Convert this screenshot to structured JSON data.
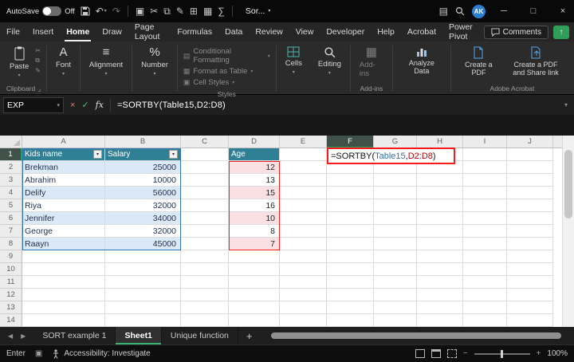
{
  "titlebar": {
    "autosave_label": "AutoSave",
    "autosave_state": "Off",
    "doc_title": "Sor...",
    "avatar": "AK"
  },
  "ribbon_tabs": {
    "items": [
      {
        "label": "File"
      },
      {
        "label": "Insert"
      },
      {
        "label": "Home"
      },
      {
        "label": "Draw"
      },
      {
        "label": "Page Layout"
      },
      {
        "label": "Formulas"
      },
      {
        "label": "Data"
      },
      {
        "label": "Review"
      },
      {
        "label": "View"
      },
      {
        "label": "Developer"
      },
      {
        "label": "Help"
      },
      {
        "label": "Acrobat"
      },
      {
        "label": "Power Pivot"
      }
    ],
    "active_tab": "Home",
    "comments_label": "Comments"
  },
  "ribbon": {
    "paste_label": "Paste",
    "font_label": "Font",
    "alignment_label": "Alignment",
    "number_label": "Number",
    "styles_items": [
      {
        "label": "Conditional Formatting"
      },
      {
        "label": "Format as Table"
      },
      {
        "label": "Cell Styles"
      }
    ],
    "cells_label": "Cells",
    "editing_label": "Editing",
    "addins_label": "Add-ins",
    "analyze_label": "Analyze Data",
    "pdf_label": "Create a PDF",
    "pdf_share_label": "Create a PDF and Share link",
    "group_labels": {
      "clipboard": "Clipboard",
      "styles": "Styles",
      "addins": "Add-ins",
      "acrobat": "Adobe Acrobat"
    }
  },
  "formula_bar": {
    "name_box": "EXP",
    "cancel": "×",
    "enter": "✓",
    "fx_label": "fx",
    "formula": "=SORTBY(Table15,D2:D8)"
  },
  "grid": {
    "col_labels": [
      "A",
      "B",
      "C",
      "D",
      "E",
      "F",
      "G",
      "H",
      "I",
      "J"
    ],
    "row_labels": [
      "1",
      "2",
      "3",
      "4",
      "5",
      "6",
      "7",
      "8",
      "9",
      "10",
      "11",
      "12",
      "13",
      "14"
    ],
    "active_cell_ref": "F1",
    "table": {
      "header_name": "Kids name",
      "header_salary": "Salary",
      "rows": [
        {
          "name": "Brekman",
          "salary": "25000"
        },
        {
          "name": "Abrahim",
          "salary": "10000"
        },
        {
          "name": "Delify",
          "salary": "56000"
        },
        {
          "name": "Riya",
          "salary": "32000"
        },
        {
          "name": "Jennifer",
          "salary": "34000"
        },
        {
          "name": "George",
          "salary": "32000"
        },
        {
          "name": "Raayn",
          "salary": "45000"
        }
      ]
    },
    "age": {
      "header": "Age",
      "values": [
        "12",
        "13",
        "15",
        "16",
        "10",
        "8",
        "7"
      ]
    },
    "active_cell": {
      "prefix": "=SORTBY(",
      "ref1": "Table15",
      "sep": ",",
      "ref2": "D2:D8",
      "suffix": ")"
    }
  },
  "sheet_tabs": {
    "items": [
      {
        "label": "SORT example 1"
      },
      {
        "label": "Sheet1"
      },
      {
        "label": "Unique function"
      }
    ],
    "active_tab": "Sheet1",
    "add_label": "+"
  },
  "status_bar": {
    "mode": "Enter",
    "accessibility": "Accessibility: Investigate",
    "zoom": "100%"
  },
  "icons": {
    "dropdown": "▾",
    "undo": "↶",
    "redo": "↷",
    "clipboard": "▣",
    "cut": "✂",
    "copy": "⧉",
    "painter": "✎",
    "borders": "⊞",
    "table": "▦",
    "sum": "∑",
    "ribbon_options": "▤",
    "minimize": "─",
    "maximize": "□",
    "close": "×",
    "font_glyph": "A",
    "alignment_glyph": "≡",
    "number_glyph": "%",
    "addins_glyph": "▦",
    "dialog_launcher": "⌟",
    "tab_prev": "◀",
    "tab_next": "▶",
    "macro": "▣",
    "zoom_out": "−",
    "zoom_in": "+",
    "share_arrow": "↑"
  },
  "colors": {
    "table_header": "#2f7f95",
    "band_blue": "#dbe9f6",
    "band_pink": "#fadfe3",
    "range_border": "#fb2020",
    "ref1_color": "#2e75b6",
    "ref2_color": "#c00000",
    "accent_green": "#27a066"
  }
}
